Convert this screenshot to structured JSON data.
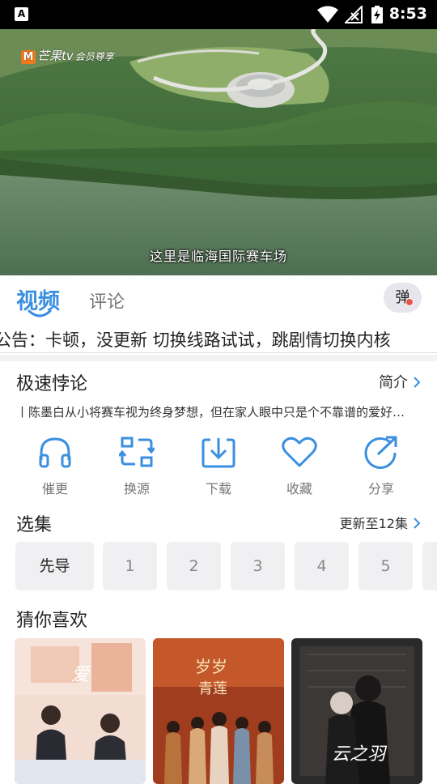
{
  "status_bar": {
    "app_badge": "A",
    "time": "8:53"
  },
  "video": {
    "brand": "芒果tv",
    "brand_tag": "会员尊享",
    "subtitle": "这里是临海国际赛车场"
  },
  "tabs": [
    {
      "label": "视频",
      "active": true
    },
    {
      "label": "评论",
      "active": false
    }
  ],
  "danmu_label": "弹",
  "notice": "公告：卡顿，没更新 切换线路试试，跳剧情切换内核",
  "show": {
    "title": "极速悖论",
    "intro_label": "简介",
    "description": "丨陈墨白从小将赛车视为终身梦想，但在家人眼中只是个不靠谱的爱好…"
  },
  "actions": [
    {
      "label": "催更",
      "icon": "headphones-icon"
    },
    {
      "label": "换源",
      "icon": "switch-source-icon"
    },
    {
      "label": "下载",
      "icon": "download-icon"
    },
    {
      "label": "收藏",
      "icon": "heart-icon"
    },
    {
      "label": "分享",
      "icon": "share-icon"
    }
  ],
  "episodes": {
    "heading": "选集",
    "update_label": "更新至12集",
    "items": [
      "先导",
      "1",
      "2",
      "3",
      "4",
      "5"
    ]
  },
  "recommend": {
    "heading": "猜你喜欢"
  },
  "colors": {
    "accent": "#3a8fe0",
    "muted": "#777777",
    "chip_bg": "#f0f0f2"
  }
}
